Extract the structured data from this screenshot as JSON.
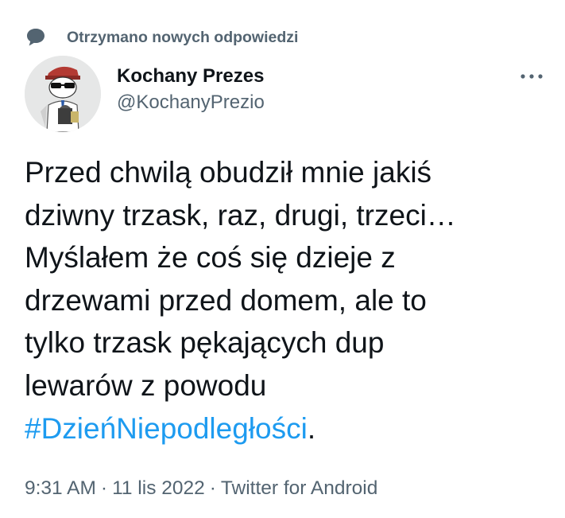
{
  "context": {
    "label": "Otrzymano nowych odpowiedzi",
    "icon": "speech-bubble-icon"
  },
  "author": {
    "display_name": "Kochany Prezes",
    "handle": "@KochanyPrezio",
    "avatar_icon": "avatar-cartoon-sunglasses"
  },
  "more_icon": "more-dots-icon",
  "tweet": {
    "lines": [
      "Przed chwilą obudził mnie jakiś",
      "dziwny trzask, raz, drugi, trzeci…",
      "Myślałem że coś się dzieje z",
      "drzewami przed domem, ale to",
      "tylko trzask pękających dup",
      "lewarów z powodu"
    ],
    "hashtag": "#DzieńNiepodległości",
    "trailing": "."
  },
  "meta": {
    "time": "9:31 AM",
    "separator": "·",
    "date": "11 lis 2022",
    "source": "Twitter for Android"
  },
  "colors": {
    "text": "#0f1419",
    "secondary": "#536471",
    "link": "#1d9bf0"
  }
}
